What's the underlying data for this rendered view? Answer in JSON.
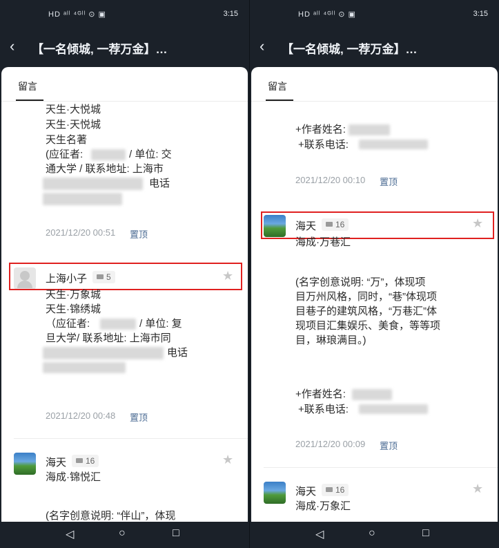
{
  "status": {
    "time": "3:15",
    "left_icons": "HD ᵃˡˡ ⁴ᴳˡˡ ⊙ ▣",
    "right_icons": "⏰ ♪ ▯"
  },
  "nav": {
    "title": "【一名倾城, 一荐万金】…"
  },
  "tab": {
    "label": "留言"
  },
  "left": {
    "c1": {
      "lines": [
        "天生·大悦城",
        "天生·天悦城",
        "天生名著",
        "(应征者:",
        "/ 单位: 交",
        "通大学 / 联系地址: 上海市",
        "电话"
      ],
      "date": "2021/12/20 00:51",
      "pin": "置顶"
    },
    "c2": {
      "name": "上海小子",
      "count": "5",
      "lines": [
        "天生·万象城",
        "天生·锦绣城",
        "（应征者:",
        "/ 单位: 复",
        "旦大学/ 联系地址: 上海市同",
        "电话"
      ],
      "date": "2021/12/20 00:48",
      "pin": "置顶"
    },
    "c3": {
      "name": "海天",
      "count": "16",
      "lines": [
        "海成·锦悦汇",
        "(名字创意说明: “伴山”，体现"
      ]
    }
  },
  "right": {
    "c1": {
      "lines": [
        "+作者姓名:",
        "+联系电话:"
      ],
      "date": "2021/12/20 00:10",
      "pin": "置顶"
    },
    "c2": {
      "name": "海天",
      "count": "16",
      "lines": [
        "海成·万巷汇",
        "(名字创意说明: “万”，体现项",
        "目万州风格，同时，“巷”体现项",
        "目巷子的建筑风格，“万巷汇”体",
        "现项目汇集娱乐、美食，等等项",
        "目，琳琅满目。)",
        "+作者姓名:",
        "+联系电话:"
      ],
      "date": "2021/12/20 00:09",
      "pin": "置顶"
    },
    "c3": {
      "name": "海天",
      "count": "16",
      "lines": [
        "海成·万象汇"
      ]
    }
  },
  "sysnav": {
    "back": "◁",
    "home": "○",
    "recent": "□"
  }
}
